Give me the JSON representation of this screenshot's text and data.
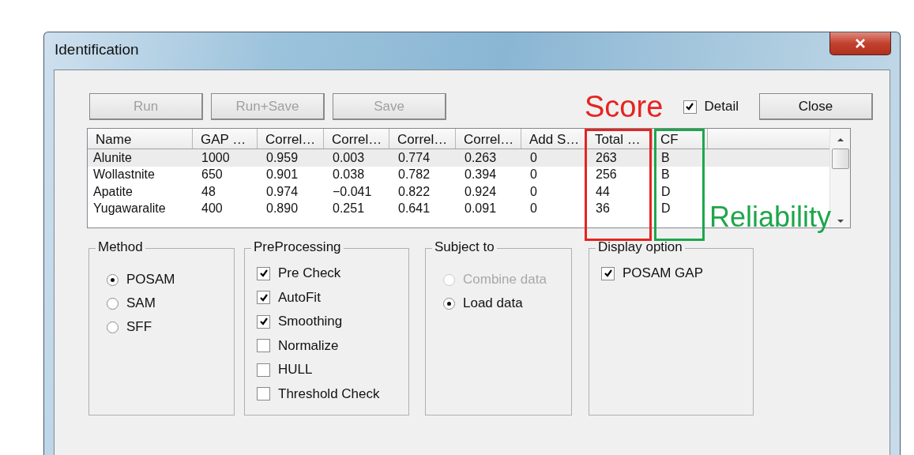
{
  "window": {
    "title": "Identification"
  },
  "toolbar": {
    "buttons": [
      {
        "label": "Run",
        "disabled": true
      },
      {
        "label": "Run+Save",
        "disabled": true
      },
      {
        "label": "Save",
        "disabled": true
      }
    ],
    "detail": {
      "label": "Detail",
      "checked": true
    },
    "close_button": {
      "label": "Close",
      "disabled": false
    }
  },
  "table": {
    "columns": [
      "Name",
      "GAP …",
      "Correl…",
      "Correl…",
      "Correl…",
      "Correl…",
      "Add S…",
      "Total …",
      "CF"
    ],
    "rows": [
      {
        "selected": true,
        "cells": [
          "Alunite",
          "1000",
          "0.959",
          "0.003",
          "0.774",
          "0.263",
          "0",
          "263",
          "B"
        ]
      },
      {
        "selected": false,
        "cells": [
          "Wollastnite",
          "650",
          "0.901",
          "0.038",
          "0.782",
          "0.394",
          "0",
          "256",
          "B"
        ]
      },
      {
        "selected": false,
        "cells": [
          "Apatite",
          "48",
          "0.974",
          "−0.041",
          "0.822",
          "0.924",
          "0",
          "44",
          "D"
        ]
      },
      {
        "selected": false,
        "cells": [
          "Yugawaralite",
          "400",
          "0.890",
          "0.251",
          "0.641",
          "0.091",
          "0",
          "36",
          "D"
        ]
      }
    ]
  },
  "groups": [
    {
      "title": "Method",
      "kind": "radio",
      "items": [
        {
          "label": "POSAM",
          "selected": true,
          "disabled": false
        },
        {
          "label": "SAM",
          "selected": false,
          "disabled": false
        },
        {
          "label": "SFF",
          "selected": false,
          "disabled": false
        }
      ]
    },
    {
      "title": "PreProcessing",
      "kind": "checkbox",
      "items": [
        {
          "label": "Pre Check",
          "checked": true
        },
        {
          "label": "AutoFit",
          "checked": true
        },
        {
          "label": "Smoothing",
          "checked": true
        },
        {
          "label": "Normalize",
          "checked": false
        },
        {
          "label": "HULL",
          "checked": false
        },
        {
          "label": "Threshold Check",
          "checked": false
        }
      ]
    },
    {
      "title": "Subject to",
      "kind": "radio",
      "items": [
        {
          "label": "Combine data",
          "selected": false,
          "disabled": true
        },
        {
          "label": "Load data",
          "selected": true,
          "disabled": false
        }
      ]
    },
    {
      "title": "Display option",
      "kind": "checkbox",
      "items": [
        {
          "label": "POSAM GAP",
          "checked": true
        }
      ]
    }
  ],
  "annotations": [
    {
      "label": "Score",
      "color": "#e52421"
    },
    {
      "label": "Reliability",
      "color": "#1ea64b"
    }
  ]
}
